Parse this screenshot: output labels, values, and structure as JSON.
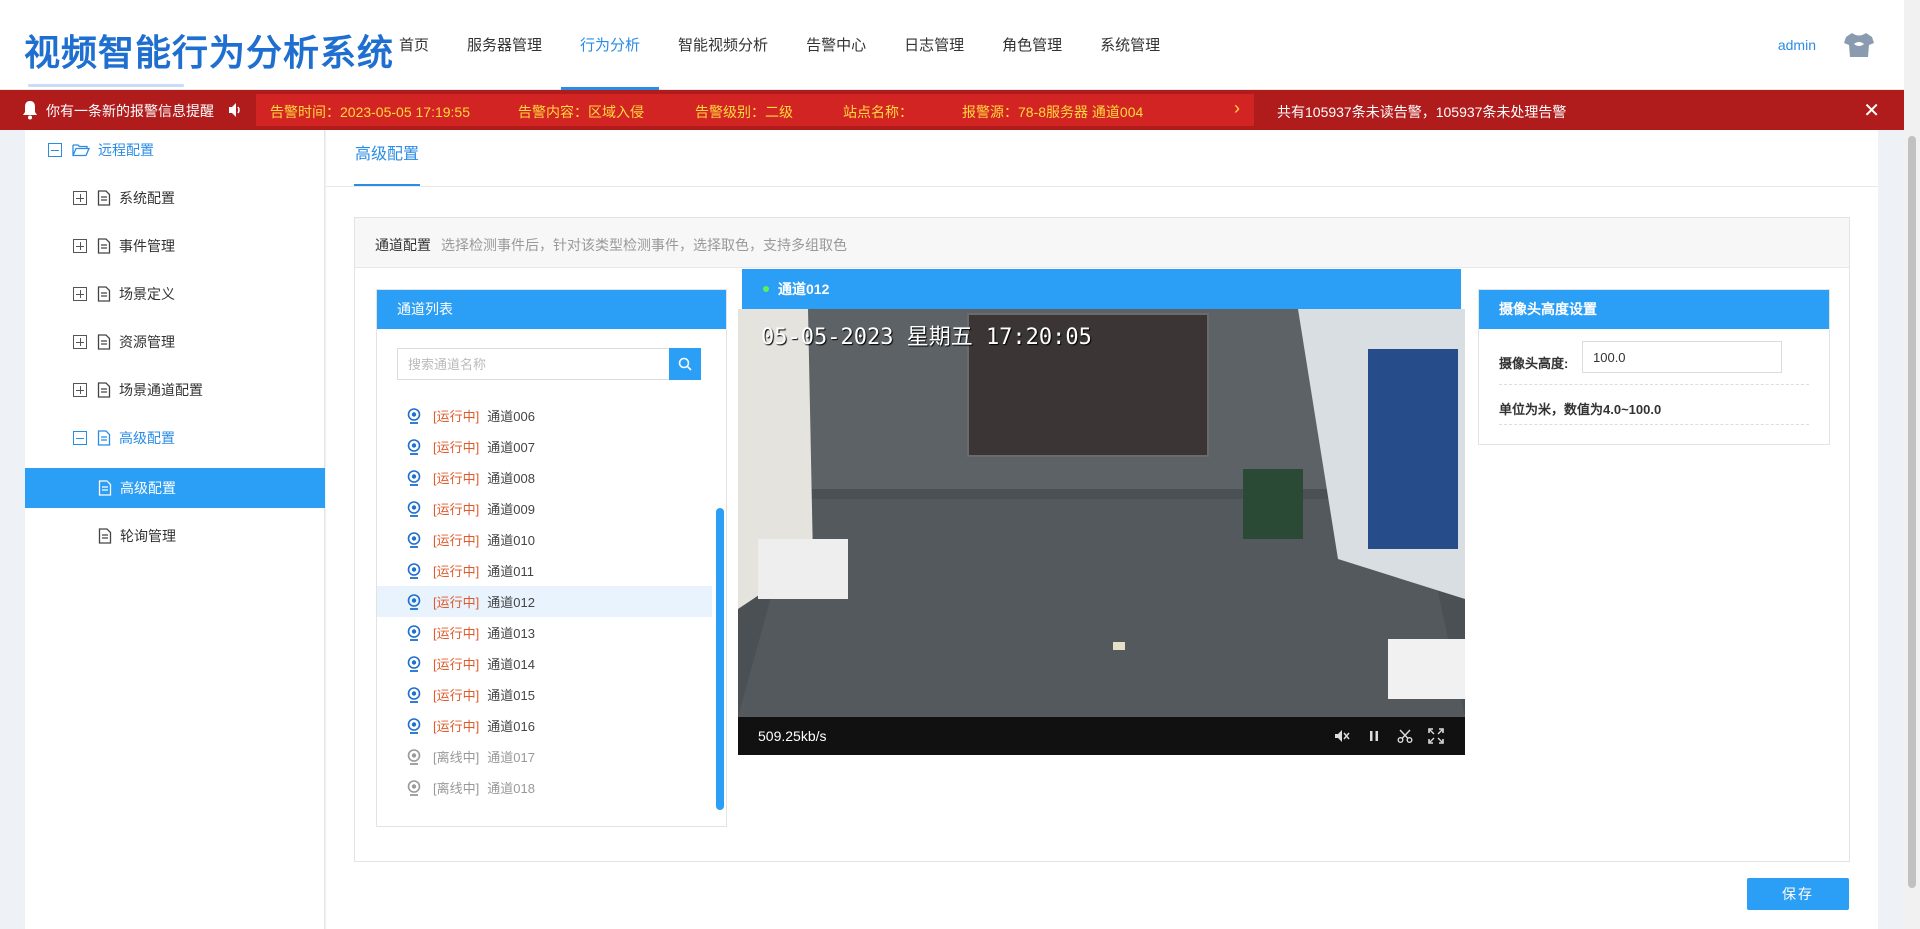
{
  "app": {
    "title": "视频智能行为分析系统"
  },
  "nav": {
    "items": [
      "首页",
      "服务器管理",
      "行为分析",
      "智能视频分析",
      "告警中心",
      "日志管理",
      "角色管理",
      "系统管理"
    ],
    "active_index": 2
  },
  "user": {
    "name": "admin"
  },
  "alert": {
    "message": "你有一条新的报警信息提醒",
    "time": "告警时间：2023-05-05 17:19:55",
    "content": "告警内容：区域入侵",
    "level": "告警级别：二级",
    "site": "站点名称：",
    "source": "报警源：78-8服务器 通道004",
    "summary": "共有105937条未读告警，105937条未处理告警"
  },
  "sidebar": {
    "items": [
      {
        "label": "远程配置",
        "kind": "folder",
        "expanded": true
      },
      {
        "label": "系统配置",
        "kind": "node",
        "expanded": false
      },
      {
        "label": "事件管理",
        "kind": "node",
        "expanded": false
      },
      {
        "label": "场景定义",
        "kind": "node",
        "expanded": false
      },
      {
        "label": "资源管理",
        "kind": "node",
        "expanded": false
      },
      {
        "label": "场景通道配置",
        "kind": "node",
        "expanded": false
      },
      {
        "label": "高级配置",
        "kind": "node",
        "expanded": true
      },
      {
        "label": "高级配置",
        "kind": "leaf",
        "selected": true
      },
      {
        "label": "轮询管理",
        "kind": "leaf",
        "selected": false
      }
    ]
  },
  "main": {
    "tab": "高级配置",
    "panel": {
      "title": "通道配置",
      "hint": "选择检测事件后，针对该类型检测事件，选择取色，支持多组取色"
    }
  },
  "channels": {
    "header": "通道列表",
    "search_placeholder": "搜索通道名称",
    "items": [
      {
        "status": "[运行中]",
        "name": "通道006",
        "online": true
      },
      {
        "status": "[运行中]",
        "name": "通道007",
        "online": true
      },
      {
        "status": "[运行中]",
        "name": "通道008",
        "online": true
      },
      {
        "status": "[运行中]",
        "name": "通道009",
        "online": true
      },
      {
        "status": "[运行中]",
        "name": "通道010",
        "online": true
      },
      {
        "status": "[运行中]",
        "name": "通道011",
        "online": true
      },
      {
        "status": "[运行中]",
        "name": "通道012",
        "online": true,
        "selected": true
      },
      {
        "status": "[运行中]",
        "name": "通道013",
        "online": true
      },
      {
        "status": "[运行中]",
        "name": "通道014",
        "online": true
      },
      {
        "status": "[运行中]",
        "name": "通道015",
        "online": true
      },
      {
        "status": "[运行中]",
        "name": "通道016",
        "online": true
      },
      {
        "status": "[离线中]",
        "name": "通道017",
        "online": false
      },
      {
        "status": "[离线中]",
        "name": "通道018",
        "online": false
      }
    ]
  },
  "video": {
    "channel": "通道012",
    "timestamp": "05-05-2023 星期五 17:20:05",
    "bitrate": "509.25kb/s"
  },
  "camera": {
    "header": "摄像头高度设置",
    "label": "摄像头高度:",
    "value": "100.0",
    "note": "单位为米，数值为4.0~100.0"
  },
  "actions": {
    "save": "保存"
  },
  "colors": {
    "accent": "#2b9ef5",
    "brand": "#1e6fd0",
    "alert_bg": "#b01c1c",
    "alert_text": "#ffd93d",
    "running": "#e05a2b"
  }
}
